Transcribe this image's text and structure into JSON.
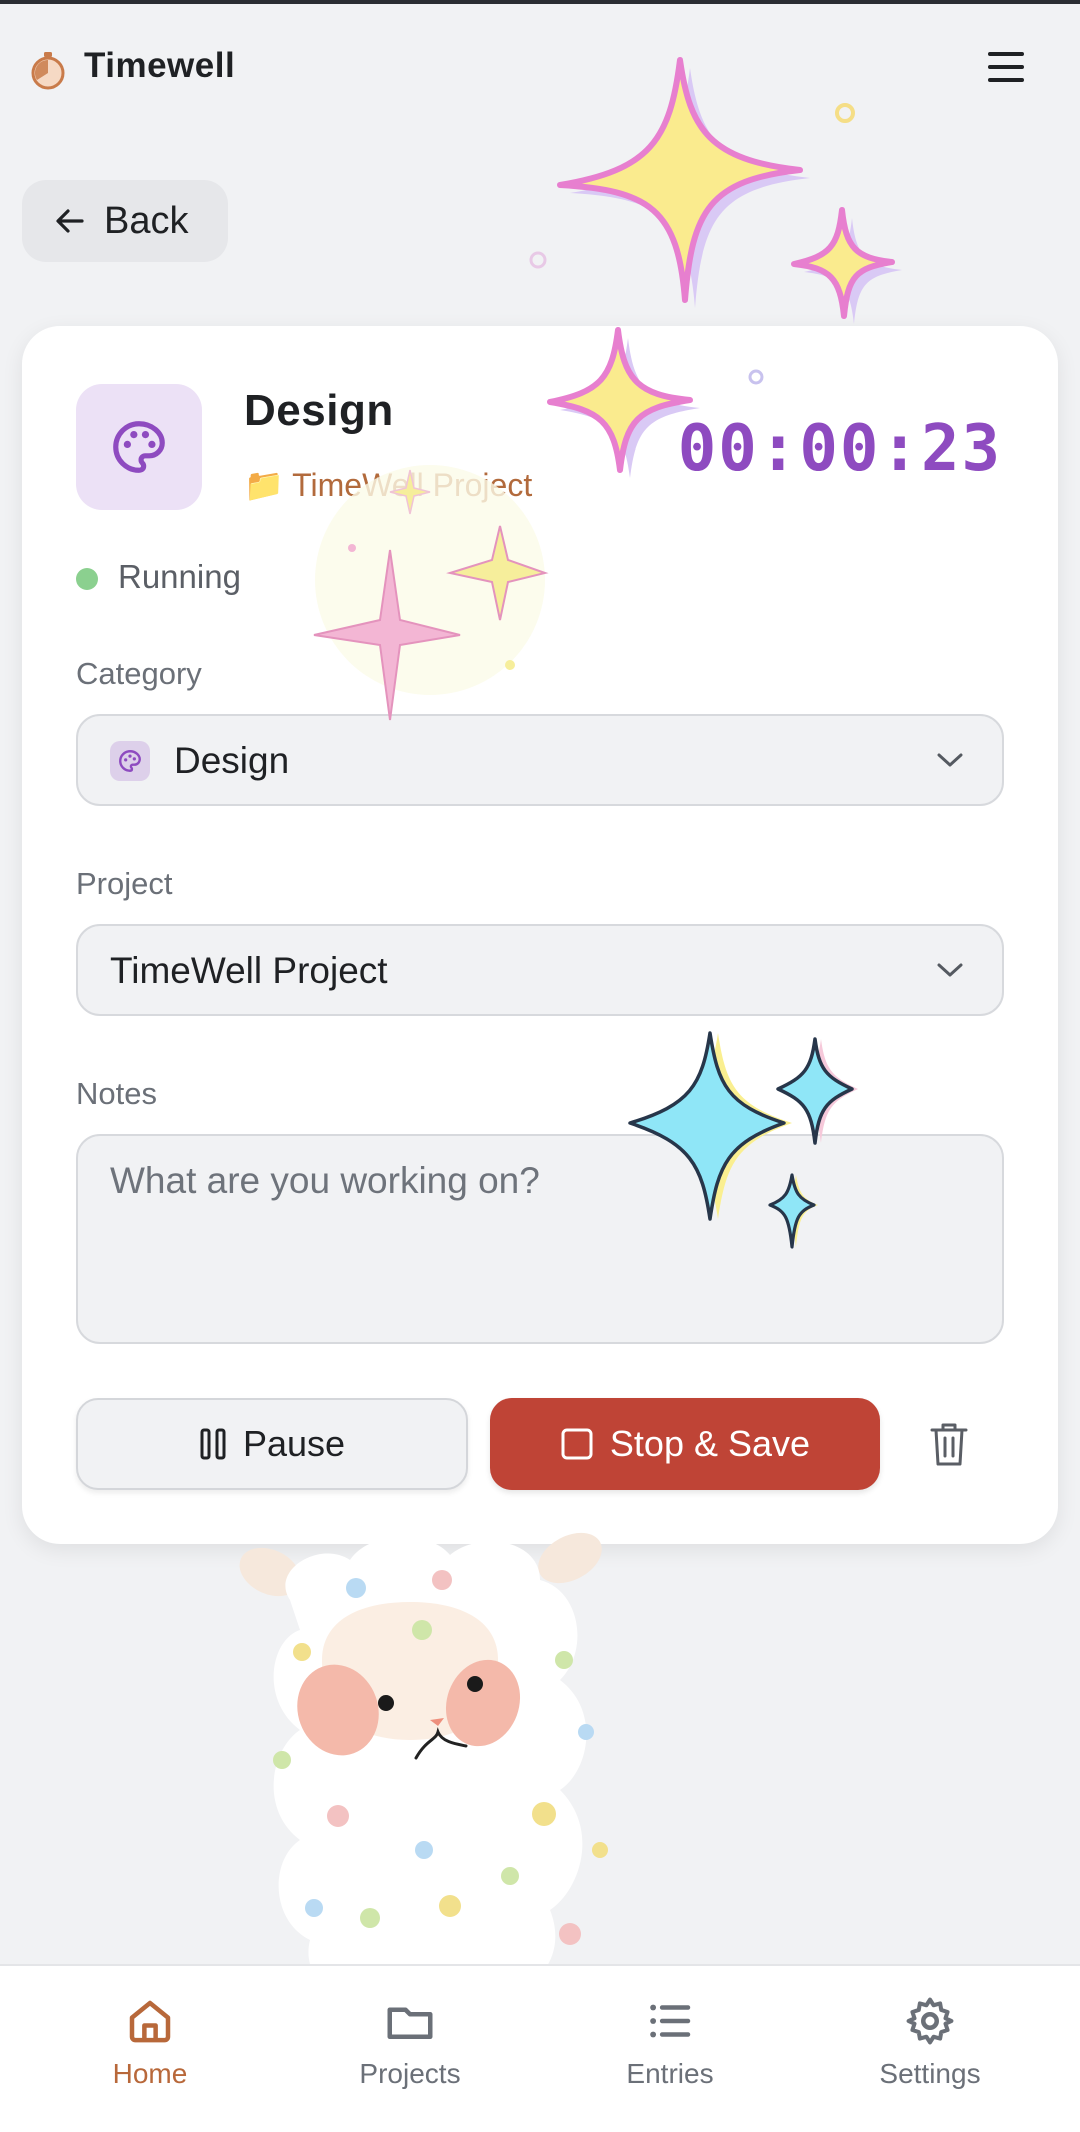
{
  "app": {
    "title": "Timewell"
  },
  "header": {
    "back_label": "Back"
  },
  "task": {
    "title": "Design",
    "project": "TimeWell Project",
    "timer": "00:00:23",
    "status": "Running"
  },
  "form": {
    "category_label": "Category",
    "category_value": "Design",
    "project_label": "Project",
    "project_value": "TimeWell Project",
    "notes_label": "Notes",
    "notes_placeholder": "What are you working on?"
  },
  "actions": {
    "pause_label": "Pause",
    "stop_label": "Stop & Save"
  },
  "nav": {
    "items": [
      {
        "label": "Home",
        "icon": "home-icon",
        "active": true
      },
      {
        "label": "Projects",
        "icon": "folder-icon",
        "active": false
      },
      {
        "label": "Entries",
        "icon": "list-icon",
        "active": false
      },
      {
        "label": "Settings",
        "icon": "gear-icon",
        "active": false
      }
    ]
  },
  "colors": {
    "accent": "#b8683a",
    "timer": "#8e4bc0",
    "stop": "#bf4436",
    "running": "#8bd08f"
  }
}
